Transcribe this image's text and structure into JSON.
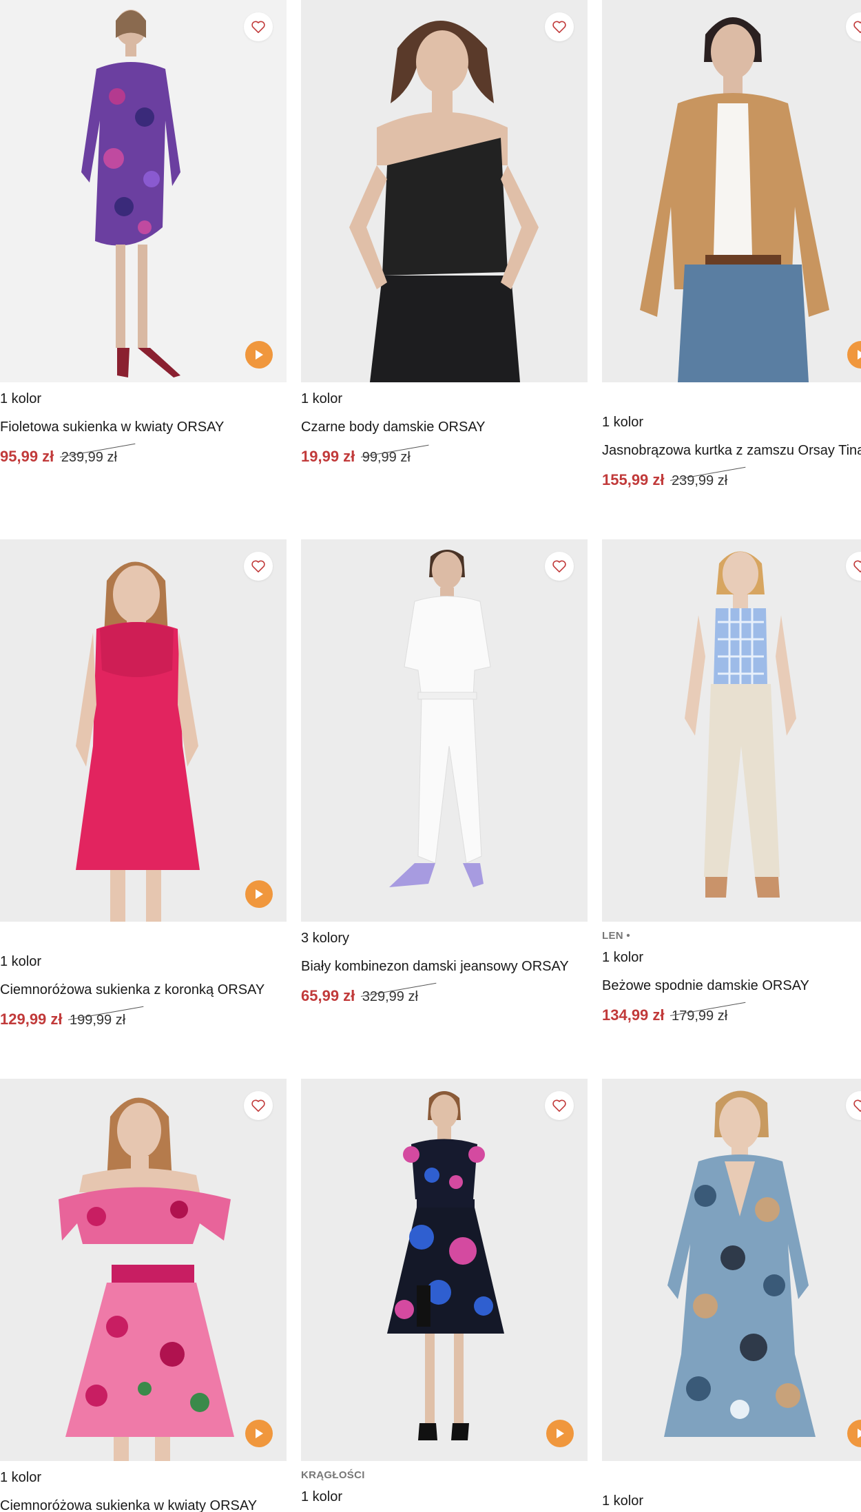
{
  "colors": {
    "sale_price": "#c13a3a",
    "play_button": "#f0973d",
    "heart_icon": "#c13a3a",
    "background": "#ffffff"
  },
  "products": [
    {
      "tag": "",
      "colors_label": "1 kolor",
      "title": "Fioletowa sukienka w kwiaty ORSAY",
      "price": "95,99 zł",
      "old_price": "239,99 zł",
      "has_play": true,
      "garment": "purple-floral-dress"
    },
    {
      "tag": "",
      "colors_label": "1 kolor",
      "title": "Czarne body damskie ORSAY",
      "price": "19,99 zł",
      "old_price": "99,99 zł",
      "has_play": false,
      "garment": "black-bodysuit"
    },
    {
      "tag": "",
      "colors_label": "1 kolor",
      "title": "Jasnobrązowa kurtka z zamszu Orsay Tina",
      "price": "155,99 zł",
      "old_price": "239,99 zł",
      "has_play": true,
      "garment": "tan-suede-jacket"
    },
    {
      "tag": "",
      "colors_label": "1 kolor",
      "title": "Ciemnoróżowa sukienka z koronką ORSAY",
      "price": "129,99 zł",
      "old_price": "199,99 zł",
      "has_play": true,
      "garment": "pink-lace-dress"
    },
    {
      "tag": "",
      "colors_label": "3 kolory",
      "title": "Biały kombinezon damski jeansowy ORSAY",
      "price": "65,99 zł",
      "old_price": "329,99 zł",
      "has_play": false,
      "garment": "white-denim-jumpsuit"
    },
    {
      "tag": "LEN •",
      "colors_label": "1 kolor",
      "title": "Beżowe spodnie damskie ORSAY",
      "price": "134,99 zł",
      "old_price": "179,99 zł",
      "has_play": false,
      "garment": "beige-trousers"
    },
    {
      "tag": "",
      "colors_label": "1 kolor",
      "title": "Ciemnoróżowa sukienka w kwiaty ORSAY",
      "price": "",
      "old_price": "",
      "has_play": true,
      "garment": "pink-floral-offshoulder-dress"
    },
    {
      "tag": "KRĄGŁOŚCI",
      "colors_label": "1 kolor",
      "title": "",
      "price": "",
      "old_price": "",
      "has_play": true,
      "garment": "navy-floral-dress"
    },
    {
      "tag": "",
      "colors_label": "1 kolor",
      "title": "",
      "price": "",
      "old_price": "",
      "has_play": true,
      "garment": "paisley-wrap-dress"
    }
  ]
}
